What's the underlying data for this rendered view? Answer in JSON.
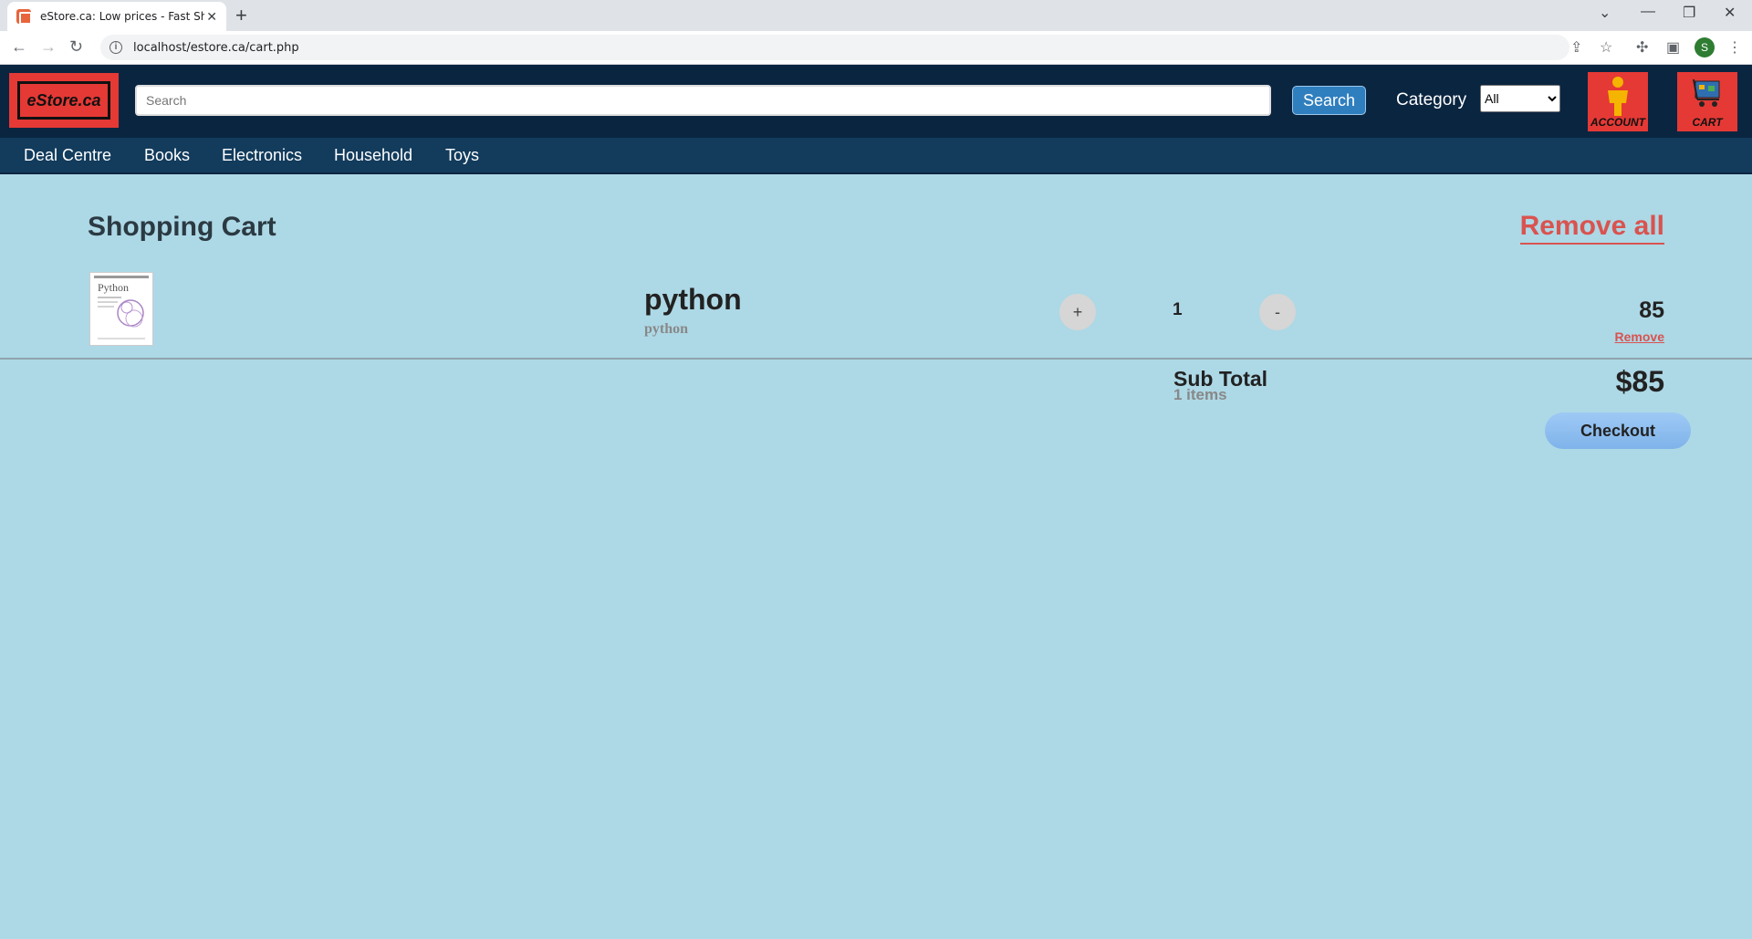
{
  "browser": {
    "tab_title": "eStore.ca: Low prices - Fast Shipp",
    "new_tab": "+",
    "url": "localhost/estore.ca/cart.php",
    "profile_initial": "S"
  },
  "header": {
    "logo_text": "eStore.ca",
    "search_placeholder": "Search",
    "search_button": "Search",
    "category_label": "Category",
    "category_selected": "All",
    "account_label": "ACCOUNT",
    "cart_label": "CART"
  },
  "nav": {
    "items": [
      "Deal Centre",
      "Books",
      "Electronics",
      "Household",
      "Toys"
    ]
  },
  "cart": {
    "title": "Shopping Cart",
    "remove_all": "Remove all",
    "items": [
      {
        "name": "python",
        "subtitle": "python",
        "increment": "+",
        "quantity": "1",
        "decrement": "-",
        "price": "85",
        "remove": "Remove"
      }
    ],
    "subtotal_label": "Sub Total",
    "subtotal_count": "1 items",
    "subtotal_amount": "$85",
    "checkout": "Checkout"
  },
  "colors": {
    "page_bg": "#add8e6",
    "header_bg": "#0a2540",
    "nav_bg": "#123b5c",
    "accent_red": "#d9534f",
    "logo_red": "#e53935"
  }
}
